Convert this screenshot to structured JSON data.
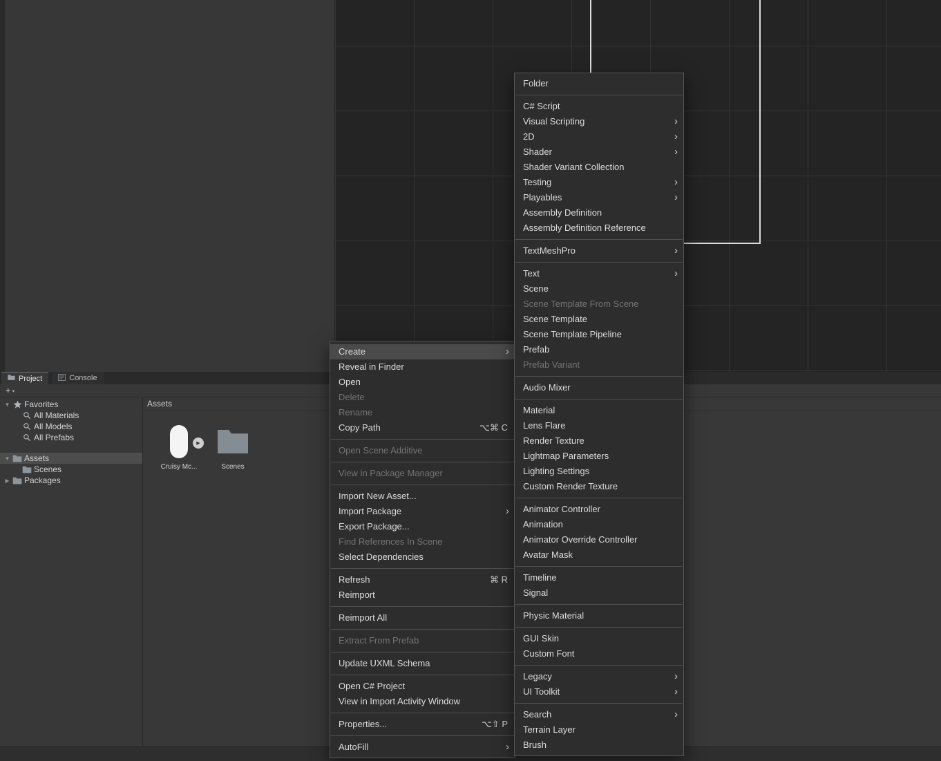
{
  "colors": {
    "panel_bg": "#383838",
    "scene_bg": "#242424",
    "menu_bg": "#2d2d2d",
    "menu_highlight": "#4a4a4a",
    "selection_bg": "#4d4d4d",
    "canvas_outline": "#dcdcdc"
  },
  "tabs": {
    "project": "Project",
    "console": "Console"
  },
  "toolbar": {
    "add_label": "+",
    "add_caret": "▾"
  },
  "project_tree": [
    {
      "label": "Favorites",
      "icon": "star",
      "expander": "open",
      "indent": 0,
      "selected": false,
      "section_gap": false
    },
    {
      "label": "All Materials",
      "icon": "search",
      "expander": "none",
      "indent": 1,
      "selected": false,
      "section_gap": false
    },
    {
      "label": "All Models",
      "icon": "search",
      "expander": "none",
      "indent": 1,
      "selected": false,
      "section_gap": false
    },
    {
      "label": "All Prefabs",
      "icon": "search",
      "expander": "none",
      "indent": 1,
      "selected": false,
      "section_gap": false
    },
    {
      "label": "Assets",
      "icon": "folder",
      "expander": "open",
      "indent": 0,
      "selected": true,
      "section_gap": true
    },
    {
      "label": "Scenes",
      "icon": "folder",
      "expander": "none",
      "indent": 1,
      "selected": false,
      "section_gap": false
    },
    {
      "label": "Packages",
      "icon": "folder",
      "expander": "closed",
      "indent": 0,
      "selected": false,
      "section_gap": false
    }
  ],
  "assets_pane": {
    "header": "Assets",
    "items": [
      {
        "label": "Cruisy Mc...",
        "kind": "prefab-capsule"
      },
      {
        "label": "Scenes",
        "kind": "folder"
      }
    ]
  },
  "context_menu": {
    "items": [
      {
        "label": "Create",
        "submenu": true,
        "highlighted": true
      },
      {
        "label": "Reveal in Finder"
      },
      {
        "label": "Open"
      },
      {
        "label": "Delete",
        "disabled": true
      },
      {
        "label": "Rename",
        "disabled": true
      },
      {
        "label": "Copy Path",
        "shortcut": "⌥⌘ C"
      },
      {
        "separator": true
      },
      {
        "label": "Open Scene Additive",
        "disabled": true
      },
      {
        "separator": true
      },
      {
        "label": "View in Package Manager",
        "disabled": true
      },
      {
        "separator": true
      },
      {
        "label": "Import New Asset..."
      },
      {
        "label": "Import Package",
        "submenu": true
      },
      {
        "label": "Export Package..."
      },
      {
        "label": "Find References In Scene",
        "disabled": true
      },
      {
        "label": "Select Dependencies"
      },
      {
        "separator": true
      },
      {
        "label": "Refresh",
        "shortcut": "⌘ R"
      },
      {
        "label": "Reimport"
      },
      {
        "separator": true
      },
      {
        "label": "Reimport All"
      },
      {
        "separator": true
      },
      {
        "label": "Extract From Prefab",
        "disabled": true
      },
      {
        "separator": true
      },
      {
        "label": "Update UXML Schema"
      },
      {
        "separator": true
      },
      {
        "label": "Open C# Project"
      },
      {
        "label": "View in Import Activity Window"
      },
      {
        "separator": true
      },
      {
        "label": "Properties...",
        "shortcut": "⌥⇧ P"
      },
      {
        "separator": true
      },
      {
        "label": "AutoFill",
        "submenu": true
      }
    ]
  },
  "create_submenu": {
    "items": [
      {
        "label": "Folder"
      },
      {
        "separator": true
      },
      {
        "label": "C# Script"
      },
      {
        "label": "Visual Scripting",
        "submenu": true
      },
      {
        "label": "2D",
        "submenu": true
      },
      {
        "label": "Shader",
        "submenu": true
      },
      {
        "label": "Shader Variant Collection"
      },
      {
        "label": "Testing",
        "submenu": true
      },
      {
        "label": "Playables",
        "submenu": true
      },
      {
        "label": "Assembly Definition"
      },
      {
        "label": "Assembly Definition Reference"
      },
      {
        "separator": true
      },
      {
        "label": "TextMeshPro",
        "submenu": true
      },
      {
        "separator": true
      },
      {
        "label": "Text",
        "submenu": true
      },
      {
        "label": "Scene"
      },
      {
        "label": "Scene Template From Scene",
        "disabled": true
      },
      {
        "label": "Scene Template"
      },
      {
        "label": "Scene Template Pipeline"
      },
      {
        "label": "Prefab"
      },
      {
        "label": "Prefab Variant",
        "disabled": true
      },
      {
        "separator": true
      },
      {
        "label": "Audio Mixer"
      },
      {
        "separator": true
      },
      {
        "label": "Material"
      },
      {
        "label": "Lens Flare"
      },
      {
        "label": "Render Texture"
      },
      {
        "label": "Lightmap Parameters"
      },
      {
        "label": "Lighting Settings"
      },
      {
        "label": "Custom Render Texture"
      },
      {
        "separator": true
      },
      {
        "label": "Animator Controller"
      },
      {
        "label": "Animation"
      },
      {
        "label": "Animator Override Controller"
      },
      {
        "label": "Avatar Mask"
      },
      {
        "separator": true
      },
      {
        "label": "Timeline"
      },
      {
        "label": "Signal"
      },
      {
        "separator": true
      },
      {
        "label": "Physic Material"
      },
      {
        "separator": true
      },
      {
        "label": "GUI Skin"
      },
      {
        "label": "Custom Font"
      },
      {
        "separator": true
      },
      {
        "label": "Legacy",
        "submenu": true
      },
      {
        "label": "UI Toolkit",
        "submenu": true
      },
      {
        "separator": true
      },
      {
        "label": "Search",
        "submenu": true
      },
      {
        "label": "Terrain Layer"
      },
      {
        "label": "Brush"
      }
    ]
  }
}
